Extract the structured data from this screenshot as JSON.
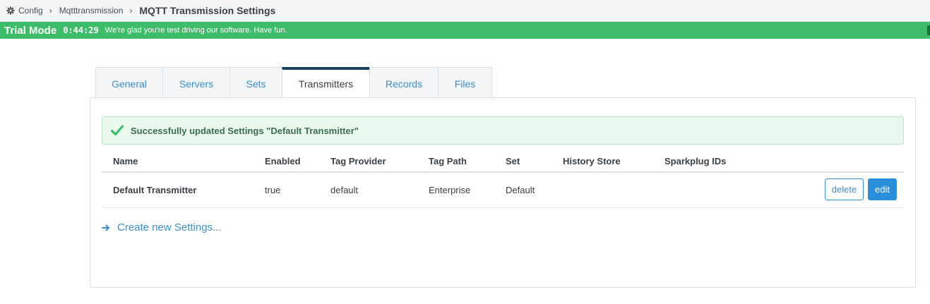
{
  "breadcrumb": {
    "items": [
      "Config",
      "Mqtttransmission"
    ],
    "current": "MQTT Transmission Settings",
    "icon": "gear-icon"
  },
  "trial": {
    "title": "Trial Mode",
    "timer": "0:44:29",
    "message": "We're glad you're test driving our software. Have fun.",
    "color": "#3dbd6a"
  },
  "tabs": [
    {
      "label": "General"
    },
    {
      "label": "Servers"
    },
    {
      "label": "Sets"
    },
    {
      "label": "Transmitters",
      "active": true
    },
    {
      "label": "Records"
    },
    {
      "label": "Files"
    }
  ],
  "alert": {
    "message": "Successfully updated Settings \"Default Transmitter\"",
    "icon": "check-icon"
  },
  "table": {
    "columns": [
      "Name",
      "Enabled",
      "Tag Provider",
      "Tag Path",
      "Set",
      "History Store",
      "Sparkplug IDs"
    ],
    "rows": [
      {
        "name": "Default Transmitter",
        "enabled": "true",
        "tag_provider": "default",
        "tag_path": "Enterprise",
        "set": "Default",
        "history_store": "",
        "sparkplug_ids": ""
      }
    ],
    "delete_label": "delete",
    "edit_label": "edit"
  },
  "create_link": {
    "label": "Create new Settings...",
    "icon": "arrow-right-icon"
  },
  "colors": {
    "accent": "#3a8fcf",
    "active_tab_border": "#1b3f5e",
    "edit_button": "#2a8fdb"
  }
}
